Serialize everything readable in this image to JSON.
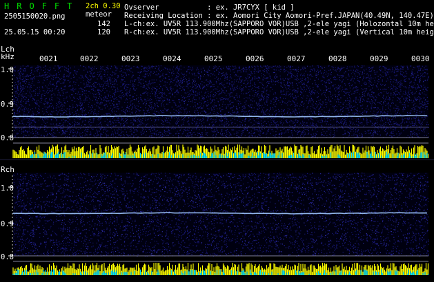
{
  "app": {
    "logo": "HROFFT",
    "version": "2ch 0.30",
    "mode": "meteor",
    "filename": "2505150020.png",
    "datetime": "25.05.15 00:20",
    "count_l": "142",
    "count_r": "120"
  },
  "info": {
    "observer": "Ovserver           : ex. JR7CYX [ kid ]",
    "location": "Receiving Location : ex. Aomori City Aomori-Pref.JAPAN(40.49N, 140.47E)",
    "lch": "L-ch:ex. UV5R 113.900Mhz(SAPPORO VOR)USB ,2-ele yagi (Holozontal 10m height)",
    "rch": "R-ch:ex. UV5R 113.900Mhz(SAPPORO VOR)USB ,2-ele yagi (Vertical 10m height)"
  },
  "left_panel": {
    "channel_label": "Lch",
    "unit_label": "kHz",
    "ticks": [
      "1.0",
      "0.9",
      "0.8"
    ]
  },
  "right_panel": {
    "channel_label": "Rch",
    "ticks": [
      "1.0",
      "0.9",
      "0.8"
    ]
  },
  "time_labels": [
    "0021",
    "0022",
    "0023",
    "0024",
    "0025",
    "0026",
    "0027",
    "0028",
    "0029",
    "0030"
  ],
  "colors": {
    "background": "#000000",
    "noise_dark": "#1a1a80",
    "signal": "#a0c8ff",
    "level_yellow": "#ffff00",
    "level_cyan": "#00e0ff",
    "logo": "#00e000"
  }
}
